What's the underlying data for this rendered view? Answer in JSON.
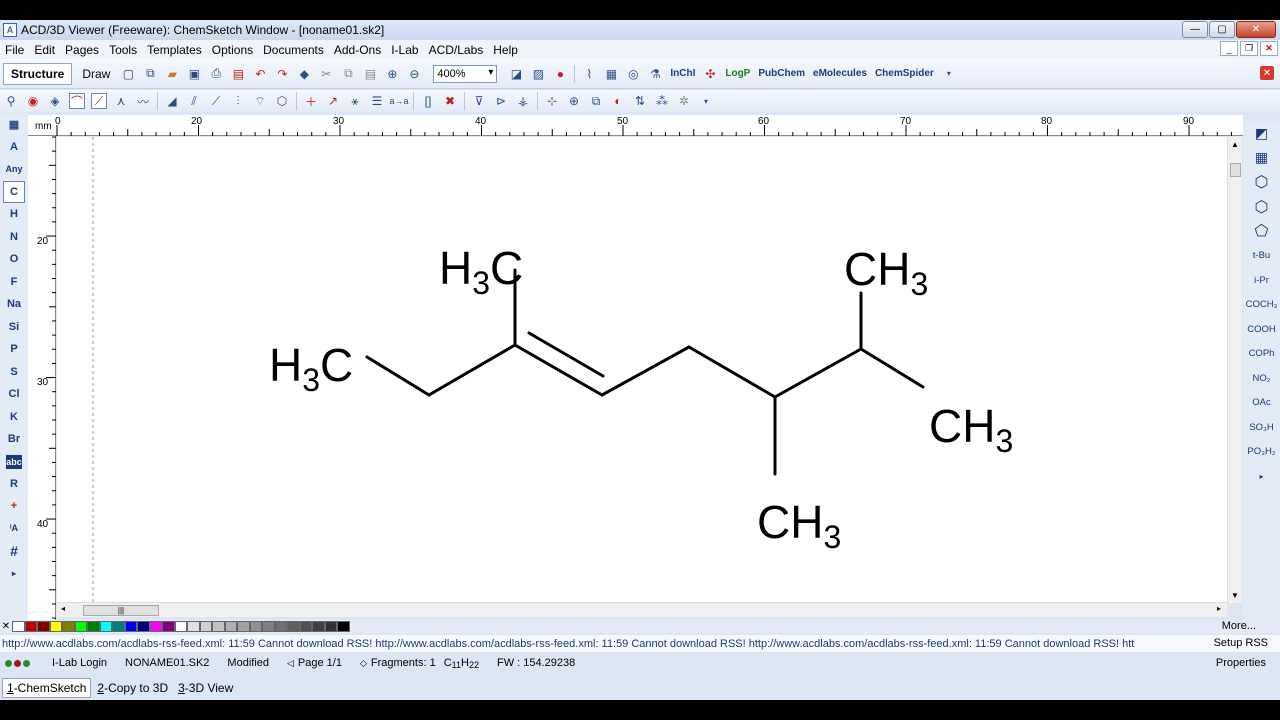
{
  "window": {
    "title": "ACD/3D Viewer (Freeware): ChemSketch Window - [noname01.sk2]",
    "minimize": "—",
    "maximize": "▢",
    "close": "✕"
  },
  "menu": [
    "File",
    "Edit",
    "Pages",
    "Tools",
    "Templates",
    "Options",
    "Documents",
    "Add-Ons",
    "I-Lab",
    "ACD/Labs",
    "Help"
  ],
  "toolbar": {
    "structure_label": "Structure",
    "draw_label": "Draw",
    "zoom_value": "400%",
    "logp": "LogP",
    "pubchem": "PubChem",
    "emolecules": "eMolecules",
    "chemspider": "ChemSpider",
    "inchi": "InChI"
  },
  "left_palette": [
    "A",
    "Any",
    "C",
    "H",
    "N",
    "O",
    "F",
    "Na",
    "Si",
    "P",
    "S",
    "Cl",
    "K",
    "Br",
    "abc",
    "R",
    "+",
    "ⁱA",
    "#"
  ],
  "right_palette": [
    "t-Bu",
    "i-Pr",
    "COCH₃",
    "COOH",
    "COPh",
    "NO₂",
    "OAc",
    "SO₃H",
    "PO₃H₂"
  ],
  "ruler": {
    "unit": "mm",
    "h_labels": [
      "0",
      "20",
      "30",
      "40",
      "50",
      "60",
      "70",
      "80",
      "90"
    ],
    "v_labels": [
      "20",
      "30",
      "40"
    ]
  },
  "molecule": {
    "labels": [
      {
        "main": "H",
        "sub": "3",
        "tail": "C"
      },
      {
        "main": "H",
        "sub": "3",
        "tail": "C"
      },
      {
        "main": "CH",
        "sub": "3",
        "tail": ""
      },
      {
        "main": "CH",
        "sub": "3",
        "tail": ""
      },
      {
        "main": "CH",
        "sub": "3",
        "tail": ""
      }
    ]
  },
  "colors": {
    "palette": [
      "#ffffff",
      "#c00000",
      "#800000",
      "#ffff00",
      "#808000",
      "#00ff00",
      "#008000",
      "#00ffff",
      "#008080",
      "#0000ff",
      "#000080",
      "#ff00ff",
      "#800080",
      "#ffffff",
      "#e0e0e0",
      "#d0d0d0",
      "#c0c0c0",
      "#b0b0b0",
      "#a0a0a0",
      "#909090",
      "#808080",
      "#707070",
      "#606060",
      "#505050",
      "#404040",
      "#303030",
      "#000000"
    ]
  },
  "color_more": "More...",
  "rss": {
    "text": "http://www.acdlabs.com/acdlabs-rss-feed.xml: 11:59 Cannot download RSS! http://www.acdlabs.com/acdlabs-rss-feed.xml: 11:59 Cannot download RSS! http://www.acdlabs.com/acdlabs-rss-feed.xml: 11:59 Cannot download RSS! htt",
    "setup": "Setup RSS"
  },
  "status": {
    "ilab": "I-Lab Login",
    "file": "NONAME01.SK2",
    "modified": "Modified",
    "page": "Page 1/1",
    "fragments": "Fragments: 1",
    "formula_c": "C",
    "formula_c_n": "11",
    "formula_h": "H",
    "formula_h_n": "22",
    "fw": "FW : 154.29238",
    "properties": "Properties"
  },
  "tabs": [
    {
      "num": "1",
      "label": "-ChemSketch"
    },
    {
      "num": "2",
      "label": "-Copy to 3D"
    },
    {
      "num": "3",
      "label": "-3D View"
    }
  ]
}
